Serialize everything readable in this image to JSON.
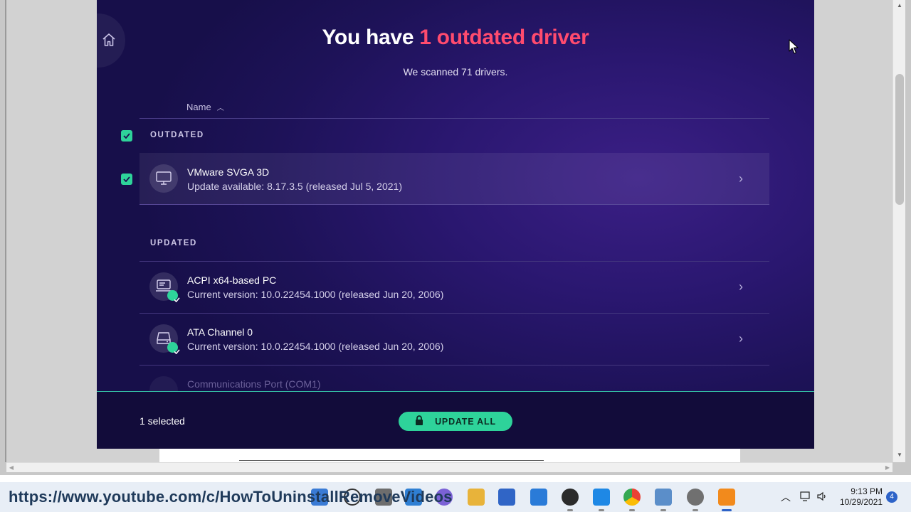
{
  "header": {
    "title_prefix": "You have ",
    "title_accent": "1 outdated driver",
    "subtitle": "We scanned 71 drivers."
  },
  "list": {
    "column_name": "Name",
    "sort_caret": "^",
    "outdated_section": "OUTDATED",
    "updated_section": "UPDATED",
    "outdated_items": [
      {
        "name": "VMware SVGA 3D",
        "detail": "Update available: 8.17.3.5 (released Jul 5, 2021)",
        "checked": true,
        "icon": "monitor-icon"
      }
    ],
    "updated_items": [
      {
        "name": "ACPI x64-based PC",
        "detail": "Current version: 10.0.22454.1000 (released Jun 20, 2006)",
        "icon": "computer-icon"
      },
      {
        "name": "ATA Channel 0",
        "detail": "Current version: 10.0.22454.1000 (released Jun 20, 2006)",
        "icon": "drive-icon"
      },
      {
        "name": "Communications Port (COM1)",
        "detail": "",
        "icon": "port-icon"
      }
    ],
    "chevron": "›"
  },
  "footer": {
    "selected_text": "1 selected",
    "update_all_label": "UPDATE ALL"
  },
  "overlay": {
    "url": "https://www.youtube.com/c/HowToUninstallRemoveVideos"
  },
  "taskbar": {
    "time": "9:13 PM",
    "date": "10/29/2021",
    "notifications": "4"
  },
  "colors": {
    "accent_red": "#ff4b6e",
    "accent_green": "#2ed39a",
    "panel_bg": "#1d1257"
  }
}
